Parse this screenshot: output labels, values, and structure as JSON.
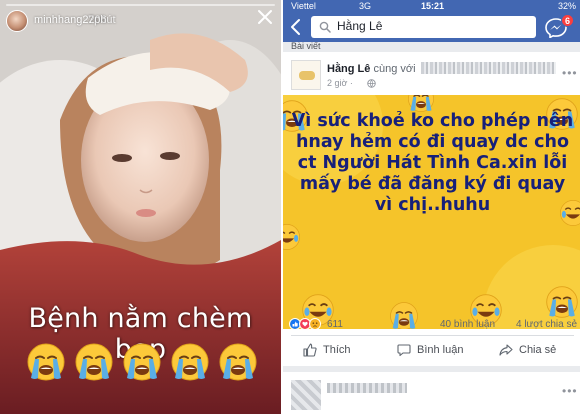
{
  "story": {
    "username": "minhhang2206",
    "time": "7phút",
    "caption": "Bệnh nằm chèm bẹp",
    "emoji_icons": [
      "loudly-crying-face-icon",
      "loudly-crying-face-icon",
      "loudly-crying-face-icon",
      "loudly-crying-face-icon",
      "loudly-crying-face-icon"
    ]
  },
  "facebook": {
    "status_bar": {
      "carrier": "Viettel",
      "network": "3G",
      "time": "15:21",
      "battery": "32%"
    },
    "search": {
      "query": "Hằng Lê"
    },
    "messenger_badge": "6",
    "section_label": "Bài viết",
    "post": {
      "author": "Hằng Lê",
      "with_text": "cùng với",
      "time": "2 giờ ·",
      "text": "Vì sức khoẻ ko cho phép nên hnay hẻm có đi quay dc cho ct Người Hát Tình Ca.xin lỗi mấy bé đã đăng ký đi quay vì chị..huhu",
      "background_color": "#f5c42a",
      "text_color": "#17207a",
      "reaction_count": "611",
      "comments": "40 bình luận",
      "shares": "4 lượt chia sẻ",
      "actions": {
        "like": "Thích",
        "comment": "Bình luận",
        "share": "Chia sẻ"
      }
    }
  },
  "colors": {
    "facebook_blue": "#4267b2",
    "badge_red": "#fa3e3e",
    "emoji_yellow": "#fcc93a",
    "tear_blue": "#5aaee6"
  }
}
